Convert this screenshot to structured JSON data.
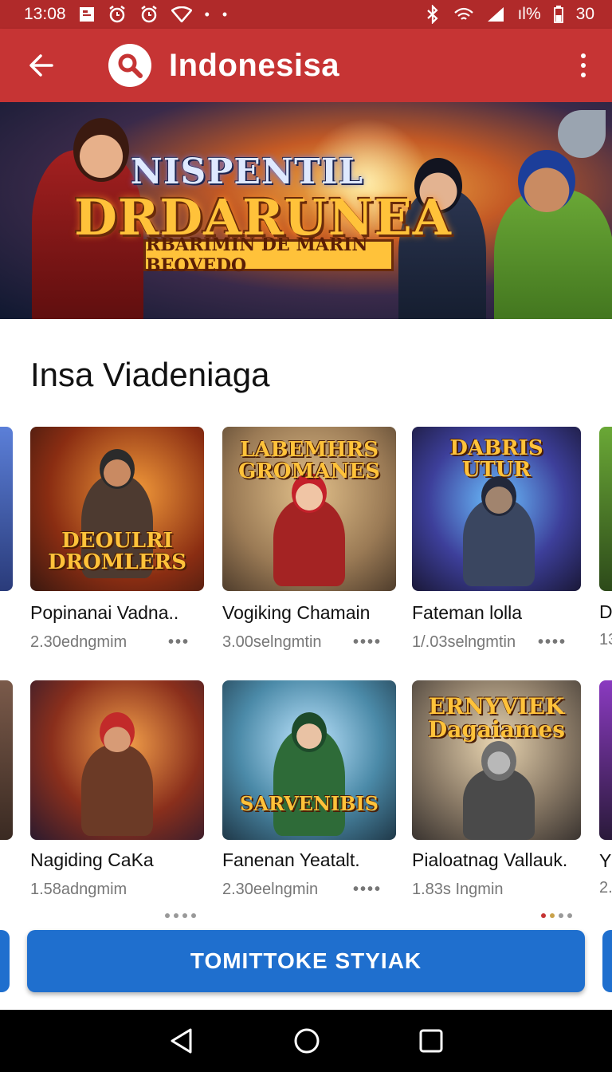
{
  "status_bar": {
    "time": "13:08",
    "battery": "ıl%",
    "battery_level": "30"
  },
  "app_bar": {
    "title": "Indonesisa"
  },
  "banner": {
    "title_line1": "NISPENTIL",
    "title_line2": "DRDARUNEA",
    "subtitle": "RBARIMIN DE MARIN BEOVEDO"
  },
  "section": {
    "title": "Insa Viadeniaga"
  },
  "row1": [
    {
      "title": "Popinanai Vadna..",
      "meta": "2.30edngmim",
      "art_text": "DEOULRI DROMLERS"
    },
    {
      "title": "Vogiking Chamain",
      "meta": "3.00selngmtin",
      "art_text": "LABEMHRS GROMANES"
    },
    {
      "title": "Fateman lolla",
      "meta": "1/.03selngmtin",
      "art_text": "DABRIS UTUR"
    }
  ],
  "row1_edge": {
    "title": "D",
    "meta": "13"
  },
  "row2": [
    {
      "title": "Nagiding CaKa",
      "meta": "1.58adngmim",
      "art_text": ""
    },
    {
      "title": "Fanenan Yeatalt.",
      "meta": "2.30eelngmin",
      "art_text": "SARVENIBIS"
    },
    {
      "title": "Pialoatnag Vallauk.",
      "meta": "1.83s Ingmin",
      "art_text": "ERNYVIEK Dagaiames"
    }
  ],
  "row2_edge": {
    "title": "Y",
    "meta": "2."
  },
  "cta": {
    "label": "TOMITTOKE STYIAK"
  },
  "colors": {
    "status_bar": "#b02a2a",
    "app_bar": "#c63434",
    "cta": "#1f6fce",
    "nav": "#000000"
  },
  "icons": {
    "back": "arrow-back-icon",
    "search": "search-icon",
    "more": "more-vert-icon",
    "nav_back": "triangle-back-icon",
    "nav_home": "circle-home-icon",
    "nav_recents": "square-recents-icon"
  }
}
